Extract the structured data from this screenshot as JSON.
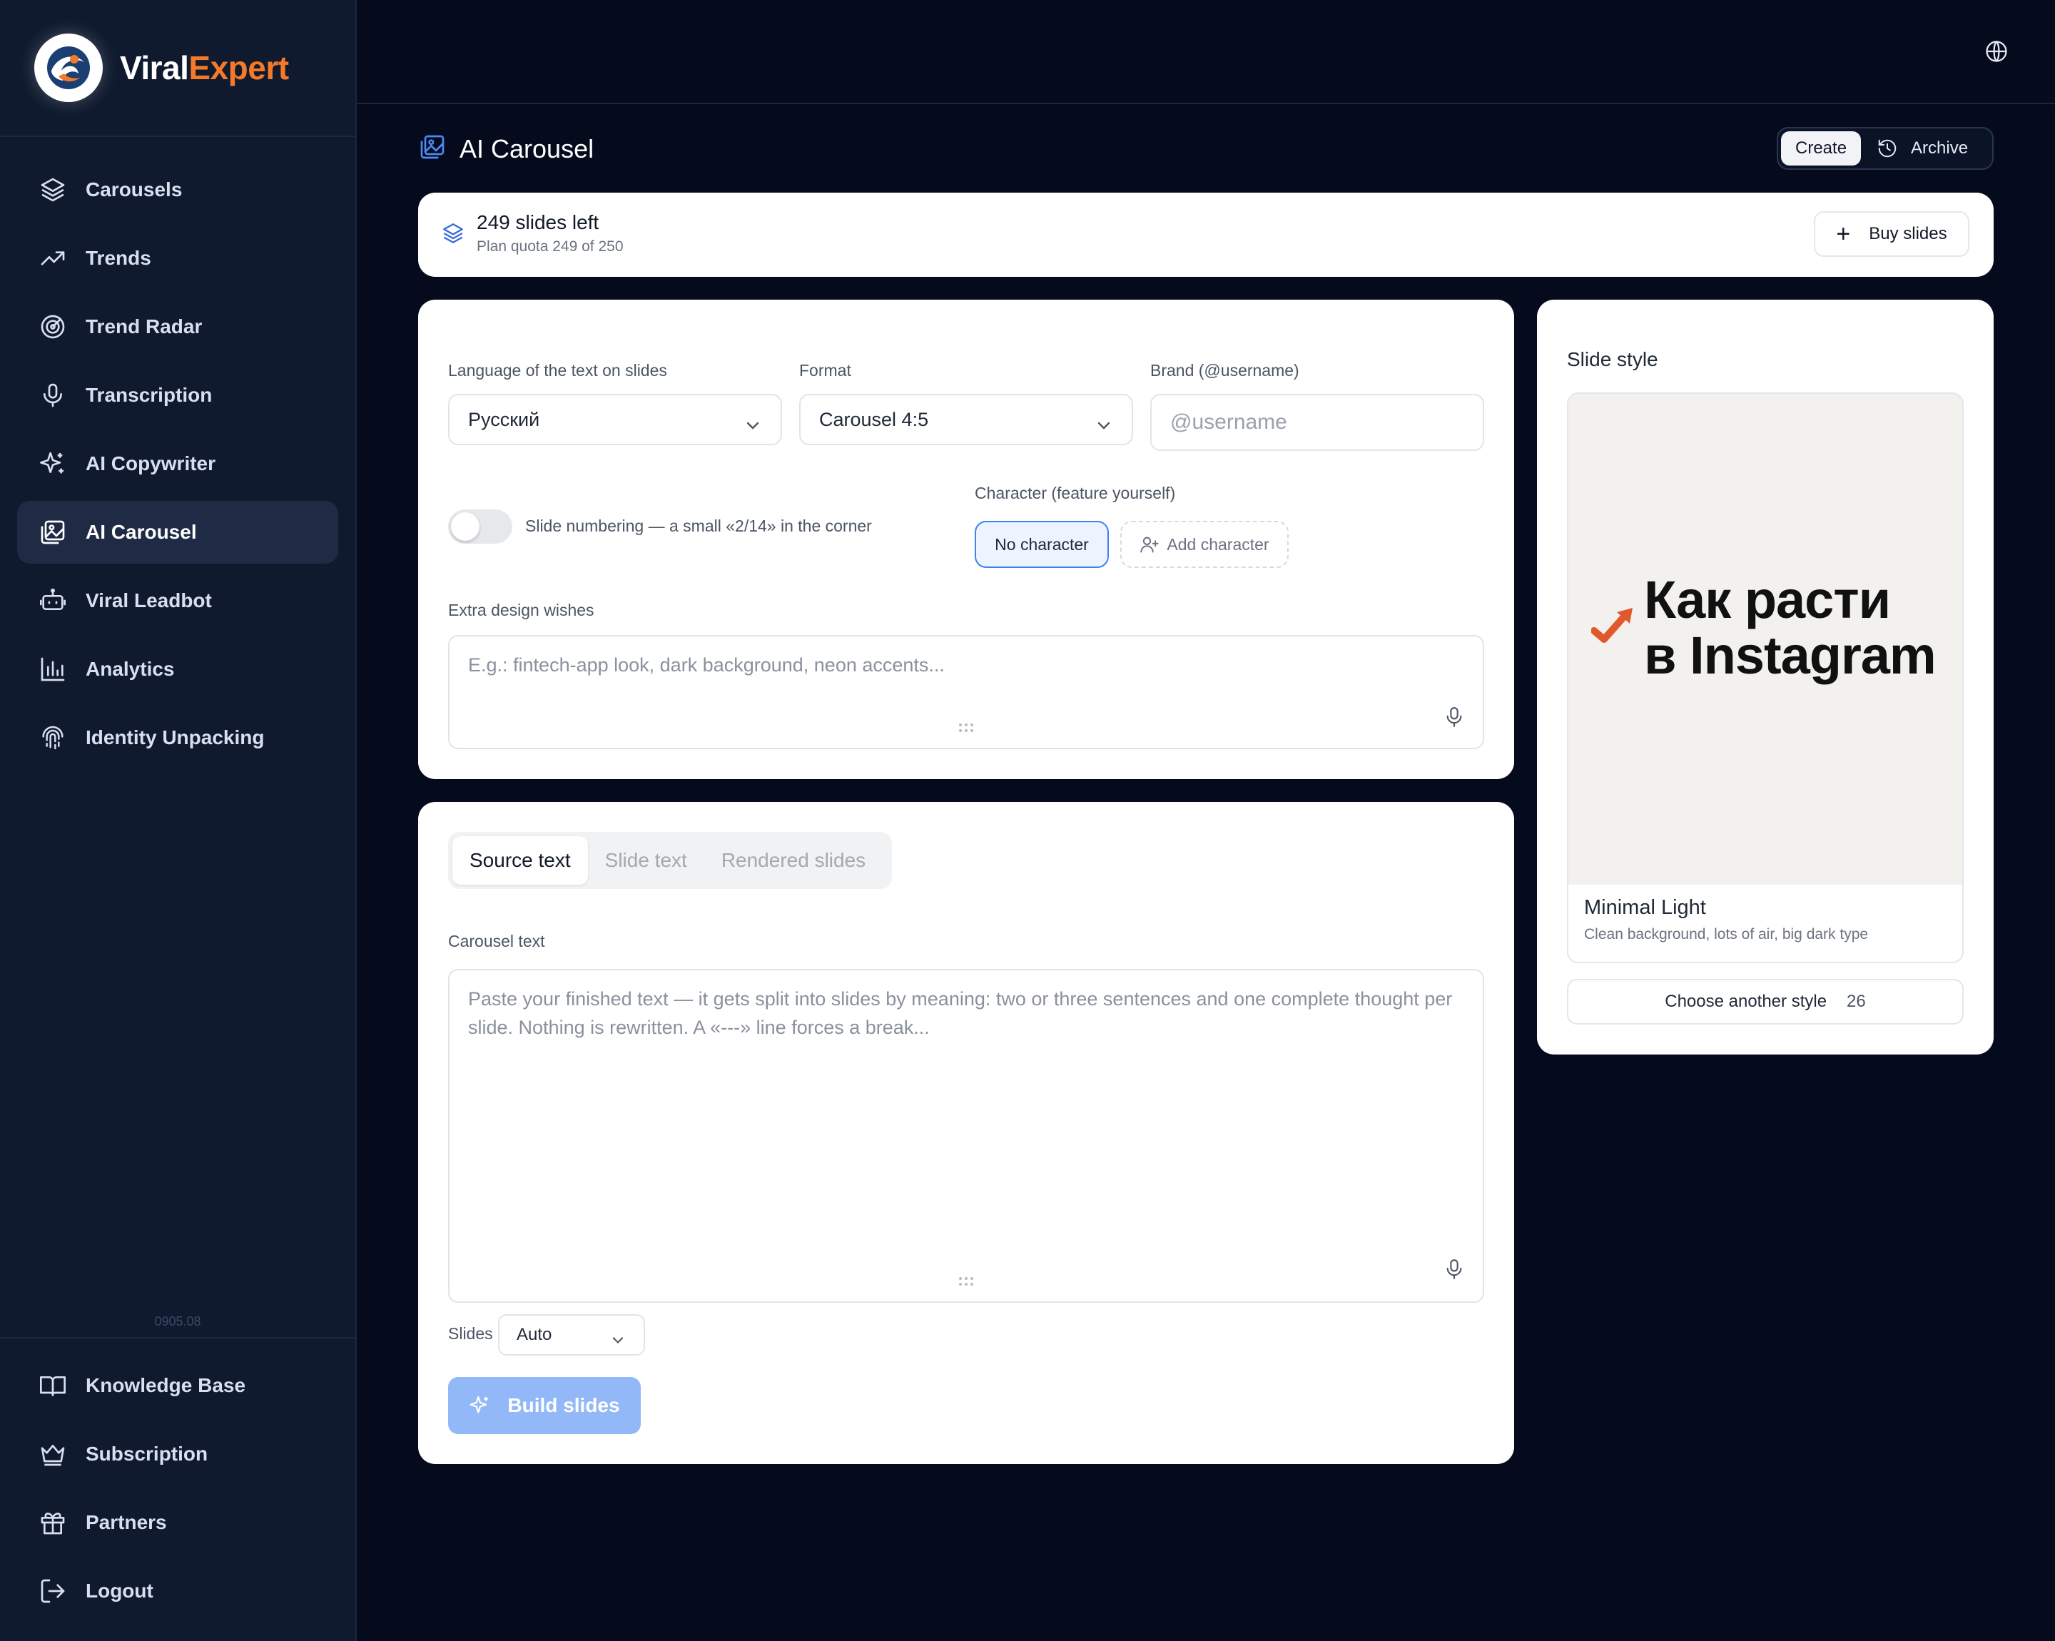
{
  "brand": {
    "name_part1": "Viral",
    "name_part2": "Expert",
    "accent": "#f47a2a"
  },
  "sidebar": {
    "items": [
      {
        "label": "Carousels",
        "icon": "layers-icon"
      },
      {
        "label": "Trends",
        "icon": "trending-up-icon"
      },
      {
        "label": "Trend Radar",
        "icon": "radar-icon"
      },
      {
        "label": "Transcription",
        "icon": "microphone-icon"
      },
      {
        "label": "AI Copywriter",
        "icon": "sparkles-icon"
      },
      {
        "label": "AI Carousel",
        "icon": "images-icon",
        "active": true
      },
      {
        "label": "Viral Leadbot",
        "icon": "bot-icon"
      },
      {
        "label": "Analytics",
        "icon": "bar-chart-icon"
      },
      {
        "label": "Identity Unpacking",
        "icon": "fingerprint-icon"
      }
    ],
    "version": "0905.08",
    "bottom_items": [
      {
        "label": "Knowledge Base",
        "icon": "book-icon"
      },
      {
        "label": "Subscription",
        "icon": "crown-icon"
      },
      {
        "label": "Partners",
        "icon": "gift-icon"
      },
      {
        "label": "Logout",
        "icon": "logout-icon"
      }
    ]
  },
  "header": {
    "title": "AI Carousel",
    "create_label": "Create",
    "archive_label": "Archive"
  },
  "quota": {
    "title": "249 slides left",
    "subtitle": "Plan quota 249 of 250",
    "buy_label": "Buy slides"
  },
  "settings": {
    "language_label": "Language of the text on slides",
    "language_value": "Русский",
    "format_label": "Format",
    "format_value": "Carousel 4:5",
    "brand_label": "Brand (@username)",
    "brand_placeholder": "@username",
    "numbering_label": "Slide numbering — a small «2/14» in the corner",
    "numbering_on": false,
    "character_label": "Character (feature yourself)",
    "no_character": "No character",
    "add_character": "Add character",
    "extra_label": "Extra design wishes",
    "extra_placeholder": "E.g.: fintech-app look, dark background, neon accents..."
  },
  "text_panel": {
    "tabs": [
      "Source text",
      "Slide text",
      "Rendered slides"
    ],
    "active_tab": "Source text",
    "carousel_label": "Carousel text",
    "carousel_placeholder": "Paste your finished text — it gets split into slides by meaning: two or three sentences and one complete thought per slide. Nothing is rewritten. A «---» line forces a break...",
    "slides_label": "Slides",
    "slides_value": "Auto",
    "build_label": "Build slides"
  },
  "style": {
    "heading": "Slide style",
    "preview_line1": "Как расти",
    "preview_line2": "в Instagram",
    "name": "Minimal Light",
    "description": "Clean background, lots of air, big dark type",
    "choose_label": "Choose another style",
    "choose_count": "26"
  }
}
